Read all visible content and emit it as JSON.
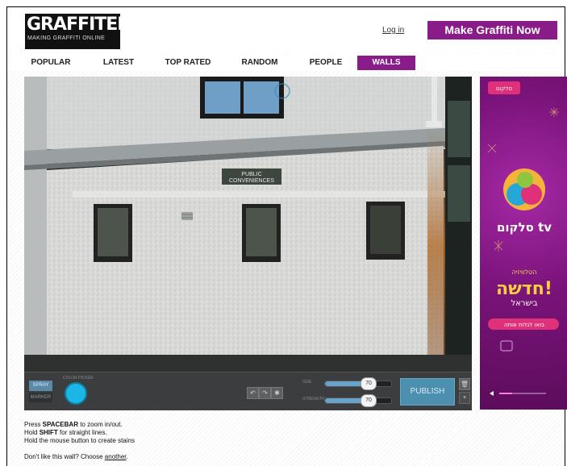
{
  "header": {
    "logo_title": "GRAFFITER",
    "logo_tagline": "MAKING GRAFFITI ONLINE",
    "login_label": "Log in",
    "cta_label": "Make Graffiti Now"
  },
  "nav": {
    "items": [
      {
        "label": "POPULAR"
      },
      {
        "label": "LATEST"
      },
      {
        "label": "TOP RATED"
      },
      {
        "label": "RANDOM"
      },
      {
        "label": "PEOPLE"
      },
      {
        "label": "WALLS"
      }
    ],
    "active": "WALLS"
  },
  "wall": {
    "sign_line1": "PUBLIC",
    "sign_line2": "CONVENIENCES"
  },
  "toolbar": {
    "spray_label": "SPRAY",
    "marker_label": "MARKER",
    "color_picker_label": "COLOR PICKER",
    "selected_color": "#1bb6e6",
    "size_label": "SIZE",
    "size_value": "70",
    "strength_label": "STRENGTH",
    "strength_value": "70",
    "publish_label": "PUBLISH",
    "undo_icon": "undo-icon",
    "redo_icon": "redo-icon",
    "clear_icon": "eraser-icon",
    "trash_icon": "trash-icon"
  },
  "ad": {
    "brand_label": "סלקום",
    "tv_label": "סלקום tv",
    "headline_small": "הטלוויזיה",
    "headline_big": "חדשה!",
    "headline_sub": "בישראל",
    "cta": "בואו לגלות אותה"
  },
  "instructions": {
    "line1_pre": "Press ",
    "line1_key": "SPACEBAR",
    "line1_post": " to zoom in/out.",
    "line2_pre": "Hold ",
    "line2_key": "SHIFT",
    "line2_post": " for straight lines.",
    "line3": "Hold the mouse button to create stains",
    "another_pre": "Don't like this wall? Choose ",
    "another_link": "another",
    "another_post": "."
  },
  "colors": {
    "brand": "#8a1c8a",
    "publish": "#4d8fae"
  }
}
